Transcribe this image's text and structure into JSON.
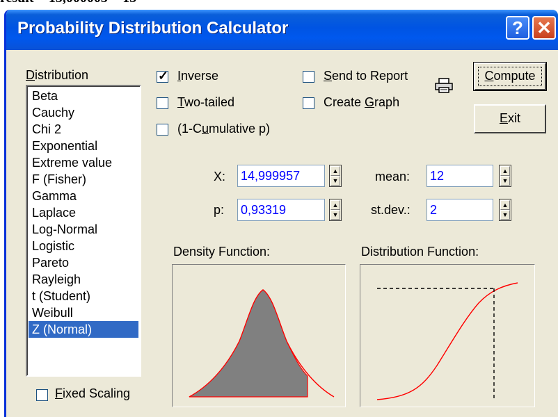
{
  "top_text": "result = 15,000003 = 15",
  "window": {
    "title": "Probability Distribution Calculator",
    "help_glyph": "?",
    "close_glyph": "✕"
  },
  "distribution": {
    "label_access": "D",
    "label_rest": "istribution",
    "items": [
      "Beta",
      "Cauchy",
      "Chi 2",
      "Exponential",
      "Extreme value",
      "F (Fisher)",
      "Gamma",
      "Laplace",
      "Log-Normal",
      "Logistic",
      "Pareto",
      "Rayleigh",
      "t (Student)",
      "Weibull",
      "Z (Normal)"
    ],
    "selected": "Z (Normal)"
  },
  "options": {
    "inverse": {
      "pre": "",
      "access": "I",
      "post": "nverse",
      "checked": true
    },
    "two_tailed": {
      "pre": "",
      "access": "T",
      "post": "wo-tailed",
      "checked": false
    },
    "one_minus_cumulative": {
      "pre": "(1-C",
      "access": "u",
      "post": "mulative p)",
      "checked": false
    },
    "send_to_report": {
      "pre": "",
      "access": "S",
      "post": "end to Report",
      "checked": false
    },
    "create_graph": {
      "pre": "Create ",
      "access": "G",
      "post": "raph",
      "checked": false
    },
    "fixed_scaling": {
      "pre": "",
      "access": "F",
      "post": "ixed Scaling",
      "checked": false
    }
  },
  "buttons": {
    "compute": {
      "access": "C",
      "rest": "ompute"
    },
    "exit": {
      "access": "E",
      "rest": "xit"
    }
  },
  "inputs": {
    "x": {
      "label": "X:",
      "value": "14,999957"
    },
    "p": {
      "label": "p:",
      "value": "0,93319"
    },
    "mean": {
      "label": "mean:",
      "value": "12"
    },
    "stdev": {
      "label": "st.dev.:",
      "value": "2"
    }
  },
  "plots": {
    "density_label": "Density Function:",
    "distribution_label": "Distribution Function:"
  },
  "icons": {
    "printer": "printer-icon",
    "spin_up": "spin-up-icon",
    "spin_down": "spin-down-icon"
  },
  "colors": {
    "title_bar": "#0054e3",
    "selection": "#316ac5",
    "input_text": "#0000ff",
    "curve": "#ff0000",
    "fill": "#808080"
  }
}
